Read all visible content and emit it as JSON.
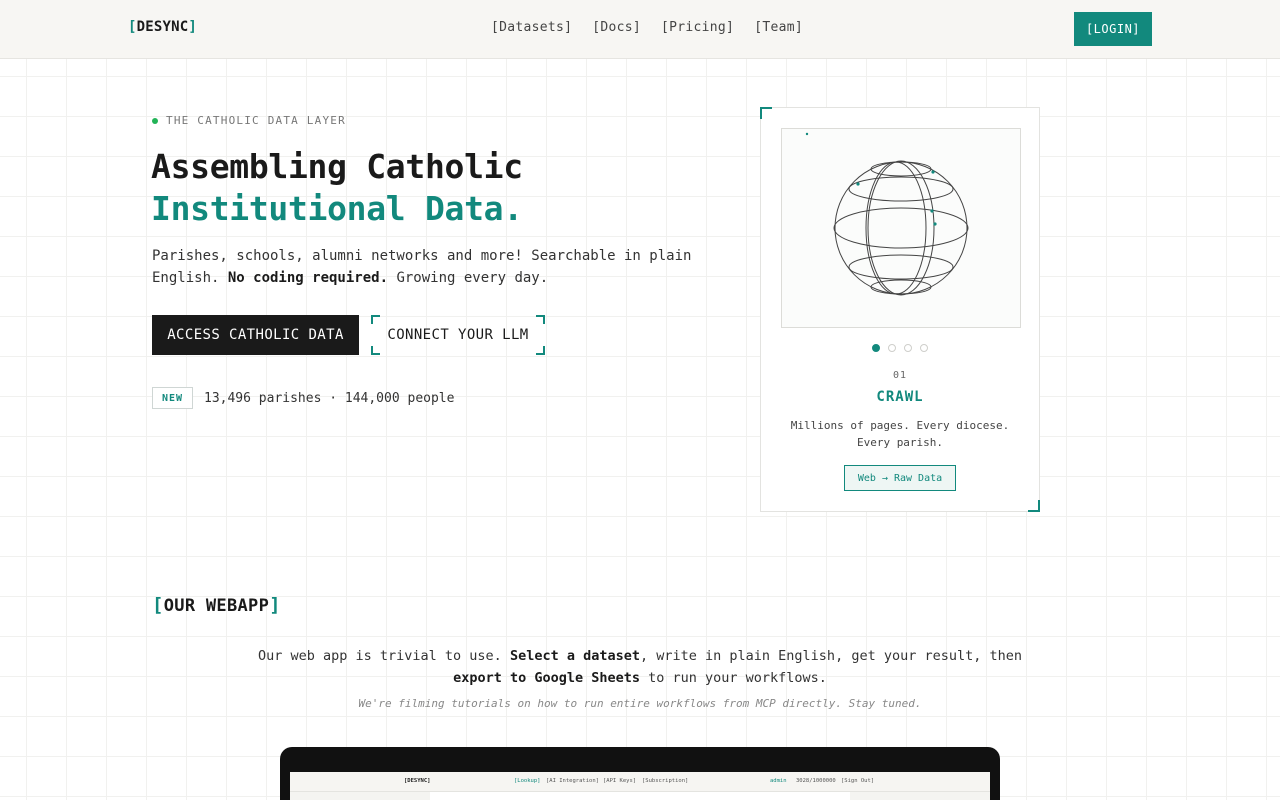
{
  "nav": {
    "logo_text": "DESYNC",
    "links": [
      "[Datasets]",
      "[Docs]",
      "[Pricing]",
      "[Team]"
    ],
    "login_label": "[LOGIN]"
  },
  "hero": {
    "eyebrow": "THE CATHOLIC DATA LAYER",
    "title_line1": "Assembling Catholic",
    "title_line2": "Institutional Data.",
    "lead_start": "Parishes, schools, alumni networks and more! Searchable in plain English. ",
    "lead_bold": "No coding required.",
    "lead_end": " Growing every day.",
    "primary_cta": "ACCESS CATHOLIC DATA",
    "secondary_cta": "CONNECT YOUR LLM",
    "new_badge": "NEW",
    "stats": "13,496 parishes · 144,000 people"
  },
  "card": {
    "active_step": 1,
    "steps_total": 4,
    "step_number": "01",
    "step_title": "CRAWL",
    "step_description": "Millions of pages. Every diocese. Every parish.",
    "step_tag": "Web → Raw Data"
  },
  "webapp": {
    "title": "OUR WEBAPP",
    "p_part1": "Our web app is trivial to use. ",
    "p_bold1": "Select a dataset",
    "p_part2": ", write in plain English, get your result, then ",
    "p_bold2": "export to Google Sheets",
    "p_part3": " to run your workflows.",
    "note": "We're filming tutorials on how to run entire workflows from MCP directly. Stay tuned.",
    "preview": {
      "logo": "[DESYNC]",
      "tabs": [
        "[Lookup]",
        "[AI Integration]",
        "[API Keys]",
        "[Subscription]"
      ],
      "user": "admin",
      "usage": "3028/1000000",
      "signout": "[Sign Out]"
    }
  },
  "colors": {
    "accent": "#12897d",
    "dark": "#1a1a1a",
    "status_dot": "#22b357"
  }
}
